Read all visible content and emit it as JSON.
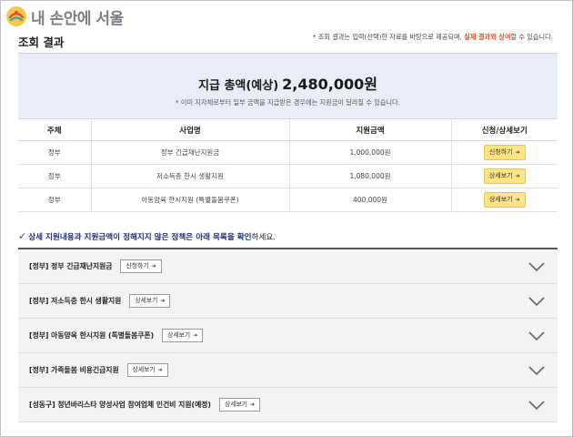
{
  "logo": {
    "text": "내 손안에 서울"
  },
  "header": {
    "title": "조회 결과",
    "notice_pre": "* 조회 결과는 입력(선택)한 자료를 바탕으로 제공되며, ",
    "notice_hl": "실제 결과와 상이",
    "notice_post": "할 수 있습니다."
  },
  "summary": {
    "label": "지급 총액(예상)",
    "amount": "2,480,000원",
    "note": "* 이미 지자체로부터 일부 금액을 지급받은 경우에는 지원금이 달라질 수 있습니다."
  },
  "table": {
    "headers": [
      "주체",
      "사업명",
      "지원금액",
      "신청/상세보기"
    ],
    "rows": [
      {
        "subject": "정부",
        "name": "정부 긴급재난지원금",
        "amount": "1,000,000원",
        "action": "신청하기"
      },
      {
        "subject": "정부",
        "name": "저소득층 한시 생활지원",
        "amount": "1,080,000원",
        "action": "상세보기"
      },
      {
        "subject": "정부",
        "name": "아동양육 한시지원 (특별돌봄쿠폰)",
        "amount": "400,000원",
        "action": "상세보기"
      }
    ]
  },
  "section": {
    "check": "✓",
    "heading": "상세 지원내용과 지원금액이 정해지지 않은 정책은 아래 목록을 확인",
    "tail": "하세요."
  },
  "accordion": [
    {
      "label": "[정부] 정부 긴급재난지원금",
      "button": "신청하기"
    },
    {
      "label": "[정부] 저소득층 한시 생활지원",
      "button": "상세보기"
    },
    {
      "label": "[정부] 아동양육 한시지원 (특별돌봄쿠폰)",
      "button": "상세보기"
    },
    {
      "label": "[정부] 가족돌봄 비용긴급지원",
      "button": "상세보기"
    },
    {
      "label": "[성동구] 청년바리스타 양성사업 참여업체 인건비 지원(예정)",
      "button": "상세보기"
    }
  ],
  "colors": {
    "accent": "#1f2f7a",
    "highlight": "#e0491c",
    "summary_bg": "#e9edf7",
    "button_yellow": "#fde584"
  },
  "icons": {
    "arrow": "arrow-right-icon",
    "chevron": "chevron-down-icon",
    "check": "check-icon"
  }
}
